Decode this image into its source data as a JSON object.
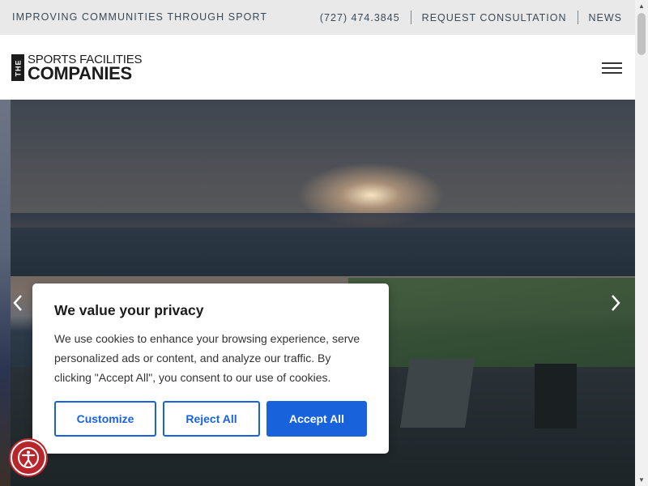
{
  "topbar": {
    "tagline": "IMPROVING COMMUNITIES THROUGH SPORT",
    "phone": "(727) 474.3845",
    "consult": "REQUEST CONSULTATION",
    "news": "NEWS"
  },
  "logo": {
    "the": "THE",
    "line1": "SPORTS FACILITIES",
    "line2": "COMPANIES"
  },
  "hero": {
    "prev_icon": "chevron-left-icon",
    "next_icon": "chevron-right-icon"
  },
  "cookie": {
    "title": "We value your privacy",
    "body": "We use cookies to enhance your browsing experience, serve personalized ads or content, and analyze our traffic. By clicking \"Accept All\", you consent to our use of cookies.",
    "customize": "Customize",
    "reject": "Reject All",
    "accept": "Accept All"
  },
  "colors": {
    "accent": "#1863dc",
    "topbar_bg": "#e9e9e9",
    "a11y_red": "#b8262c"
  },
  "icons": {
    "menu": "hamburger-menu-icon",
    "accessibility": "accessibility-icon"
  }
}
